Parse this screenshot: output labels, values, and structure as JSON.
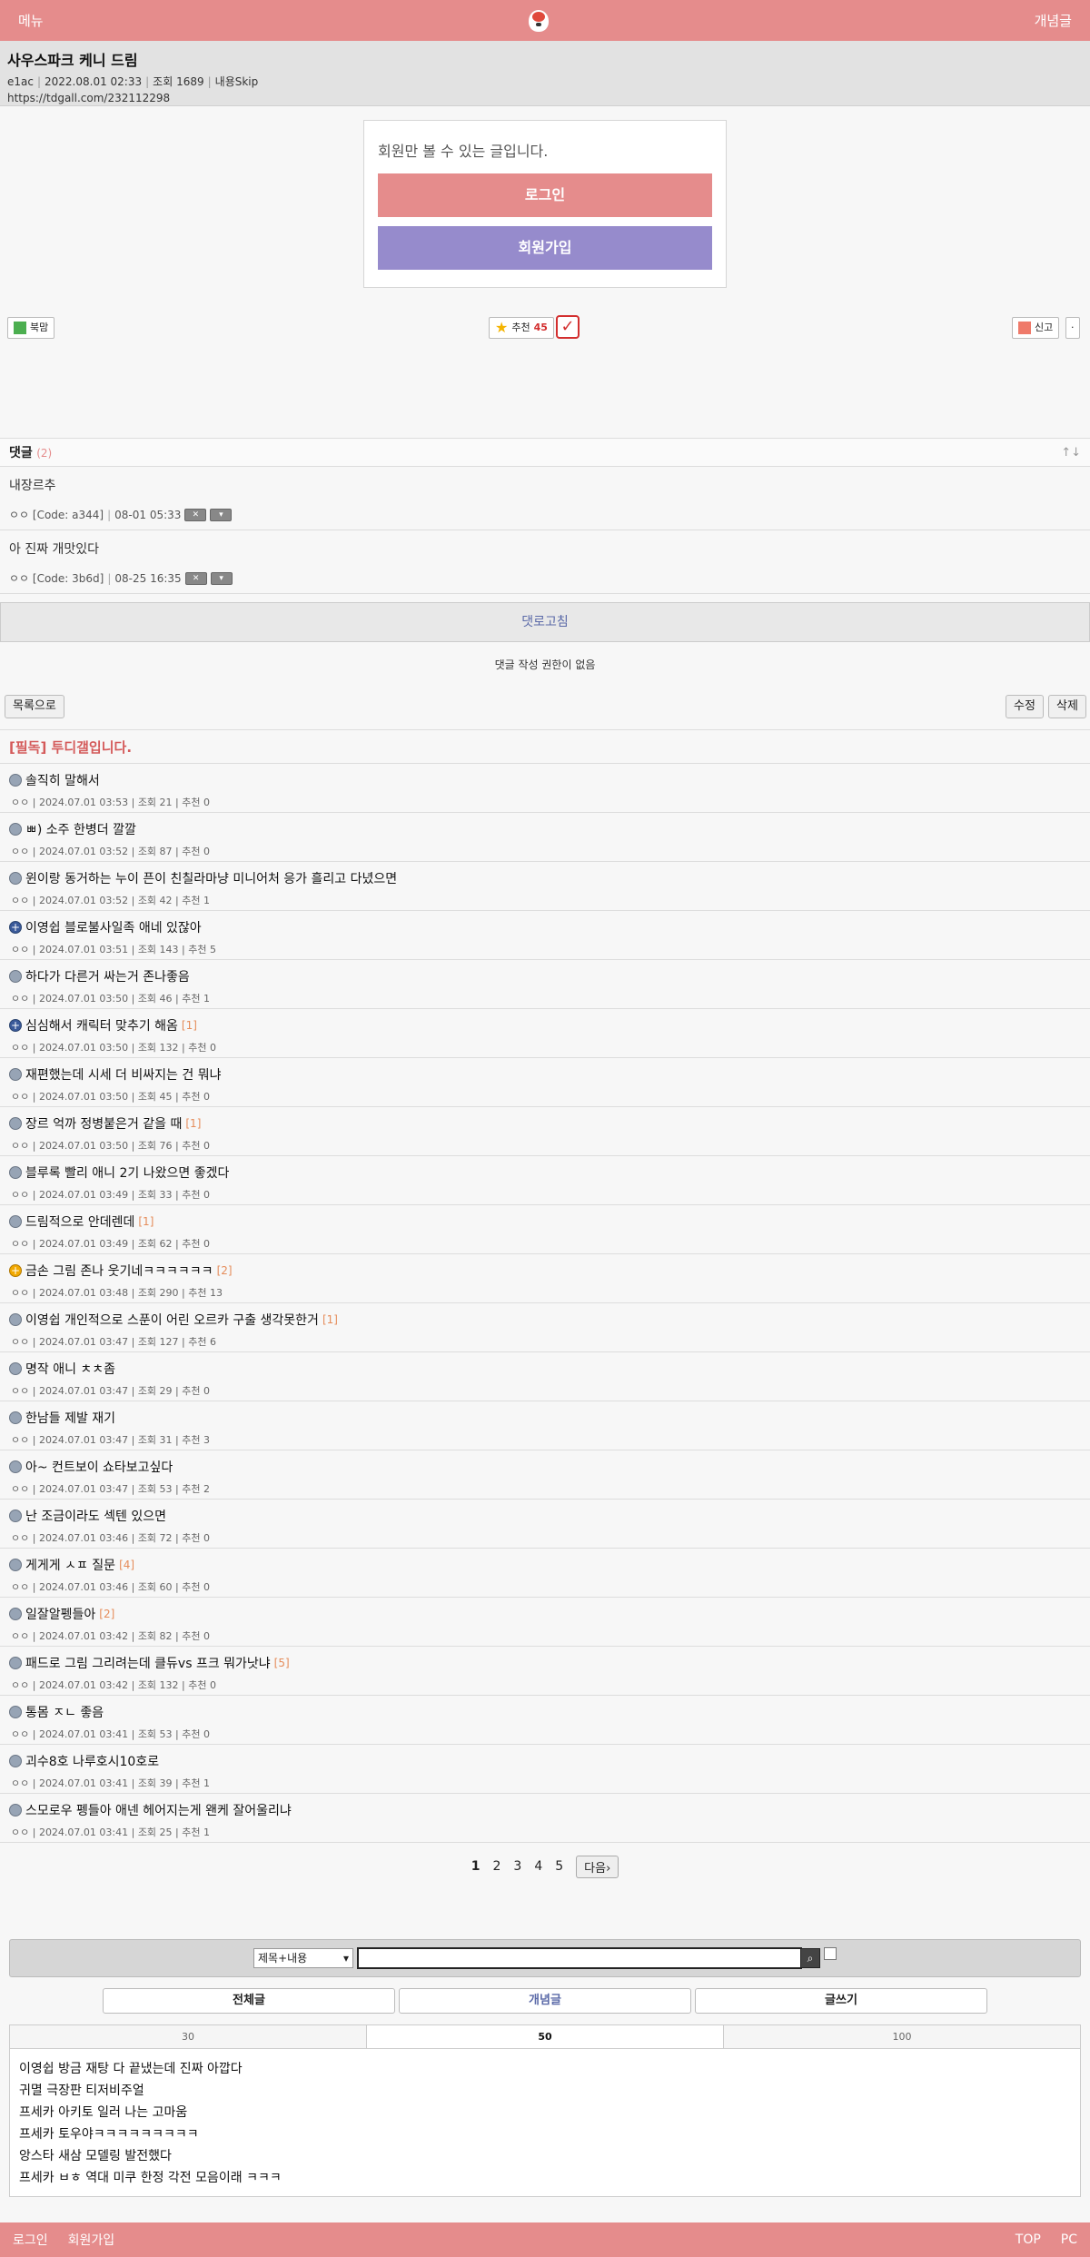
{
  "topbar": {
    "menu": "메뉴",
    "best": "개념글"
  },
  "post": {
    "title": "사우스파크 케니 드림",
    "author": "e1ac",
    "date": "2022.08.01 02:33",
    "views": "조회 1689",
    "skip": "내용Skip",
    "url": "https://tdgall.com/232112298"
  },
  "members": {
    "msg": "회원만 볼 수 있는 글입니다.",
    "login": "로그인",
    "join": "회원가입"
  },
  "actions": {
    "bookmark": "북맘",
    "recommend": "추천",
    "recommend_count": "45",
    "report": "신고",
    "more": "·"
  },
  "comments": {
    "label": "댓글",
    "count": "(2)",
    "arrows": "↑↓",
    "items": [
      {
        "text": "내장르추",
        "author": "ㅇㅇ [Code: a344]",
        "date": "08-01 05:33"
      },
      {
        "text": "아 진짜 개맛있다",
        "author": "ㅇㅇ [Code: 3b6d]",
        "date": "08-25 16:35"
      }
    ],
    "refresh": "댓로고침",
    "no_permission": "댓글 작성 권한이 없음"
  },
  "listbar": {
    "list": "목록으로",
    "edit": "수정",
    "delete": "삭제"
  },
  "notice": "[필독] 투디갤입니다.",
  "posts": [
    {
      "title": "솔직히 말해서",
      "reply": "",
      "icon": "gray",
      "meta": "ㅇㅇ | 2024.07.01 03:53 | 조회 21 | 추천 0"
    },
    {
      "title": "ㅃ) 소주 한병더 깔깔",
      "reply": "",
      "icon": "gray",
      "meta": "ㅇㅇ | 2024.07.01 03:52 | 조회 87 | 추천 0"
    },
    {
      "title": "윈이랑 동거하는 누이 픈이 친칠라마냥 미니어처 응가 흘리고 다녔으면",
      "reply": "",
      "icon": "gray",
      "meta": "ㅇㅇ | 2024.07.01 03:52 | 조회 42 | 추천 1"
    },
    {
      "title": "이영쉽 블로불사일족 애네 있잖아",
      "reply": "",
      "icon": "plus",
      "meta": "ㅇㅇ | 2024.07.01 03:51 | 조회 143 | 추천 5"
    },
    {
      "title": "하다가 다른거 싸는거 존나좋음",
      "reply": "",
      "icon": "gray",
      "meta": "ㅇㅇ | 2024.07.01 03:50 | 조회 46 | 추천 1"
    },
    {
      "title": "심심해서 캐릭터 맞추기 해옴",
      "reply": "[1]",
      "icon": "plus",
      "meta": "ㅇㅇ | 2024.07.01 03:50 | 조회 132 | 추천 0"
    },
    {
      "title": "재편했는데 시세 더 비싸지는 건 뭐냐",
      "reply": "",
      "icon": "gray",
      "meta": "ㅇㅇ | 2024.07.01 03:50 | 조회 45 | 추천 0"
    },
    {
      "title": "장르 억까 정병붙은거 같을 때",
      "reply": "[1]",
      "icon": "gray",
      "meta": "ㅇㅇ | 2024.07.01 03:50 | 조회 76 | 추천 0"
    },
    {
      "title": "블루록 빨리 애니 2기 나왔으면 좋겠다",
      "reply": "",
      "icon": "gray",
      "meta": "ㅇㅇ | 2024.07.01 03:49 | 조회 33 | 추천 0"
    },
    {
      "title": "드림적으로 안데렌데",
      "reply": "[1]",
      "icon": "gray",
      "meta": "ㅇㅇ | 2024.07.01 03:49 | 조회 62 | 추천 0"
    },
    {
      "title": "금손 그림 존나 웃기네ㅋㅋㅋㅋㅋㅋ",
      "reply": "[2]",
      "icon": "gold",
      "meta": "ㅇㅇ | 2024.07.01 03:48 | 조회 290 | 추천 13"
    },
    {
      "title": "이영쉽 개인적으로 스푼이 어린 오르카 구출 생각못한거",
      "reply": "[1]",
      "icon": "gray",
      "meta": "ㅇㅇ | 2024.07.01 03:47 | 조회 127 | 추천 6"
    },
    {
      "title": "명작 애니 ㅊㅊ좀",
      "reply": "",
      "icon": "gray",
      "meta": "ㅇㅇ | 2024.07.01 03:47 | 조회 29 | 추천 0"
    },
    {
      "title": "한남들 제발 재기",
      "reply": "",
      "icon": "gray",
      "meta": "ㅇㅇ | 2024.07.01 03:47 | 조회 31 | 추천 3"
    },
    {
      "title": "아~ 컨트보이 쇼타보고싶다",
      "reply": "",
      "icon": "gray",
      "meta": "ㅇㅇ | 2024.07.01 03:47 | 조회 53 | 추천 2"
    },
    {
      "title": "난 조금이라도 섹텐 있으면",
      "reply": "",
      "icon": "gray",
      "meta": "ㅇㅇ | 2024.07.01 03:46 | 조회 72 | 추천 0"
    },
    {
      "title": "게게게 ㅅㅍ 질문",
      "reply": "[4]",
      "icon": "gray",
      "meta": "ㅇㅇ | 2024.07.01 03:46 | 조회 60 | 추천 0"
    },
    {
      "title": "일잘알펭들아",
      "reply": "[2]",
      "icon": "gray",
      "meta": "ㅇㅇ | 2024.07.01 03:42 | 조회 82 | 추천 0"
    },
    {
      "title": "패드로 그림 그리려는데 클듀vs 프크 뭐가낫냐",
      "reply": "[5]",
      "icon": "gray",
      "meta": "ㅇㅇ | 2024.07.01 03:42 | 조회 132 | 추천 0"
    },
    {
      "title": "통몸 ㅈㄴ 좋음",
      "reply": "",
      "icon": "gray",
      "meta": "ㅇㅇ | 2024.07.01 03:41 | 조회 53 | 추천 0"
    },
    {
      "title": "괴수8호 나루호시10호로",
      "reply": "",
      "icon": "gray",
      "meta": "ㅇㅇ | 2024.07.01 03:41 | 조회 39 | 추천 1"
    },
    {
      "title": "스모로우 펭들아 애넨 헤어지는게 왠케 잘어울리냐",
      "reply": "",
      "icon": "gray",
      "meta": "ㅇㅇ | 2024.07.01 03:41 | 조회 25 | 추천 1"
    }
  ],
  "pager": {
    "pages": [
      "1",
      "2",
      "3",
      "4",
      "5"
    ],
    "next": "다음›"
  },
  "search": {
    "select": "제목+내용",
    "button_icon": "search-icon"
  },
  "tabs": {
    "all": "전체글",
    "best": "개념글",
    "write": "글쓰기"
  },
  "recent": {
    "tabs": [
      "30",
      "50",
      "100"
    ],
    "items": [
      "이영쉽 방금 재탕 다 끝냈는데 진짜 아깝다",
      "귀멸 극장판 티저비주얼",
      "프세카 아키토 일러 나는 고마움",
      "프세카 토우야ㅋㅋㅋㅋㅋㅋㅋㅋㅋ",
      "앙스타 새삼 모델링 발전했다",
      "프세카 ㅂㅎ 역대 미쿠 한정 각전 모음이래 ㅋㅋㅋ"
    ]
  },
  "footer": {
    "login": "로그인",
    "join": "회원가입",
    "top": "TOP",
    "pc": "PC"
  },
  "colors": {
    "accent": "#e58c8c",
    "purple": "#968bcc"
  }
}
